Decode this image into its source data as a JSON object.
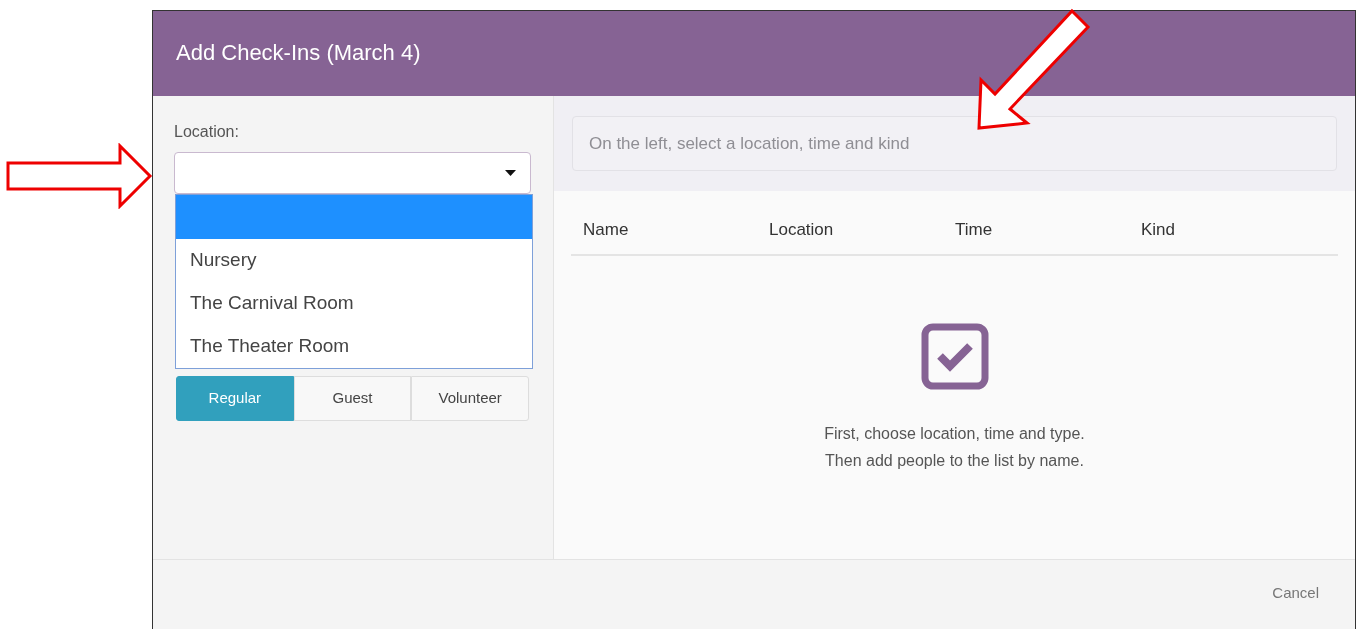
{
  "dialog": {
    "title": "Add Check-Ins (March 4)"
  },
  "location": {
    "label": "Location:",
    "expanded": true,
    "options": [
      {
        "selected": true
      },
      {
        "label": "Nursery",
        "selected": false
      },
      {
        "label": "The Carnival Room",
        "selected": false
      },
      {
        "label": "The Theater Room",
        "selected": false
      }
    ]
  },
  "kinds": [
    {
      "label": "Regular",
      "selected": true
    },
    {
      "label": "Guest",
      "selected": false
    },
    {
      "label": "Volunteer",
      "selected": false
    }
  ],
  "search": {
    "placeholder": "On the left, select a location, time and kind"
  },
  "table": {
    "columns": [
      "Name",
      "Location",
      "Time",
      "Kind"
    ]
  },
  "empty_state": {
    "lines": [
      "First, choose location, time and type.",
      "Then add people to the list by name."
    ]
  },
  "footer": {
    "buttons": [
      "Cancel"
    ]
  }
}
